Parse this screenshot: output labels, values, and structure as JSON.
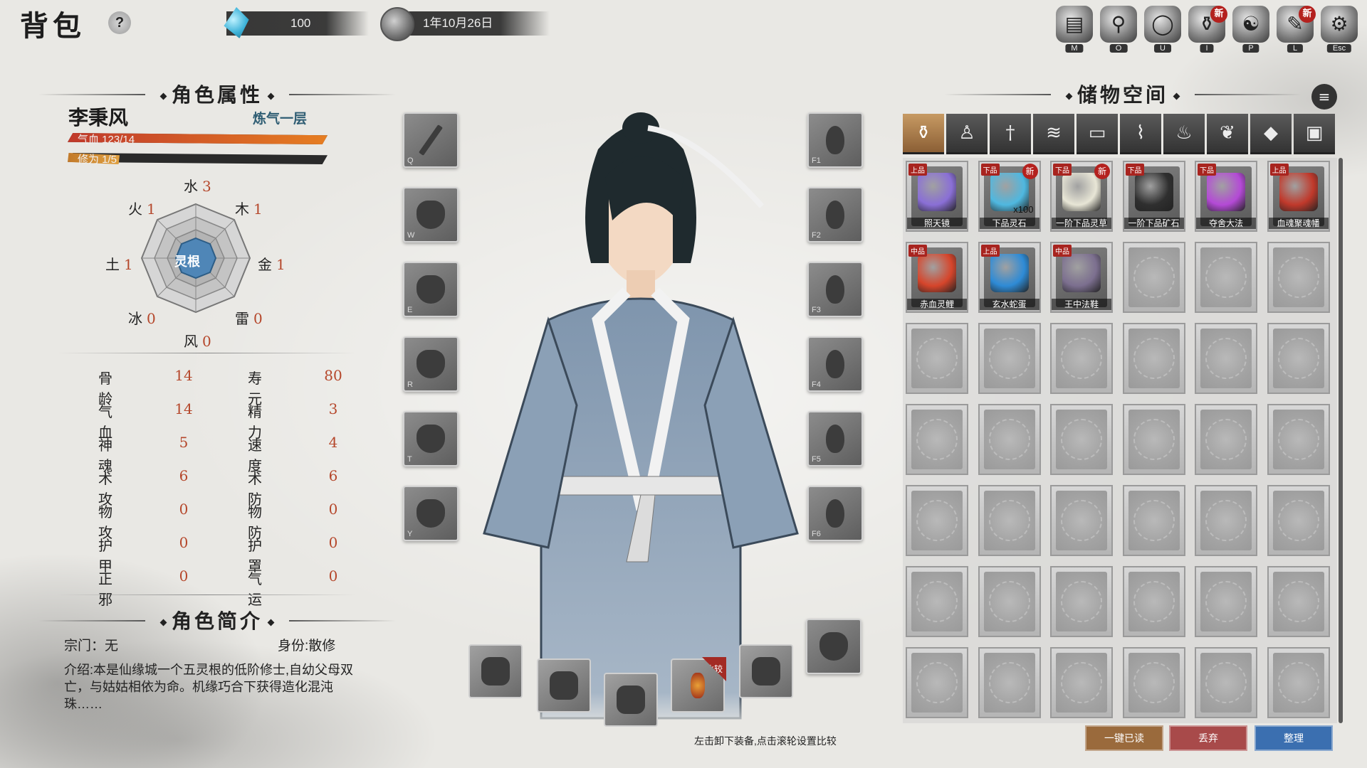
{
  "header": {
    "title": "背包",
    "help": "?",
    "spirit_stone": "100",
    "date": "1年10月26日",
    "menu": [
      {
        "icon": "map-scroll-icon",
        "glyph": "▤",
        "key": "M",
        "new": false
      },
      {
        "icon": "bone-icon",
        "glyph": "⚲",
        "key": "O",
        "new": false
      },
      {
        "icon": "crystal-ball-icon",
        "glyph": "◯",
        "key": "U",
        "new": false
      },
      {
        "icon": "gourd-bag-icon",
        "glyph": "⚱",
        "key": "I",
        "new": true
      },
      {
        "icon": "yin-yang-icon",
        "glyph": "☯",
        "key": "P",
        "new": false
      },
      {
        "icon": "book-brush-icon",
        "glyph": "✎",
        "key": "L",
        "new": true
      },
      {
        "icon": "gear-icon",
        "glyph": "⚙",
        "key": "Esc",
        "new": false
      }
    ],
    "new_label": "新"
  },
  "attributes": {
    "heading": "角色属性",
    "name": "李秉风",
    "rank": "炼气一层",
    "hp_label": "气血 123/14",
    "hp_fraction": 1.0,
    "cultivation_label": "修为 1/5",
    "cultivation_fraction": 0.2,
    "spirit_root": "灵根",
    "elements": [
      {
        "name": "水",
        "value": "3"
      },
      {
        "name": "木",
        "value": "1"
      },
      {
        "name": "金",
        "value": "1"
      },
      {
        "name": "雷",
        "value": "0"
      },
      {
        "name": "风",
        "value": "0"
      },
      {
        "name": "冰",
        "value": "0"
      },
      {
        "name": "土",
        "value": "1"
      },
      {
        "name": "火",
        "value": "1"
      }
    ],
    "stats": [
      {
        "name": "骨龄",
        "value": "14"
      },
      {
        "name": "寿元",
        "value": "80"
      },
      {
        "name": "气血",
        "value": "14"
      },
      {
        "name": "精力",
        "value": "3"
      },
      {
        "name": "神魂",
        "value": "5"
      },
      {
        "name": "速度",
        "value": "4"
      },
      {
        "name": "术攻",
        "value": "6"
      },
      {
        "name": "术防",
        "value": "6"
      },
      {
        "name": "物攻",
        "value": "0"
      },
      {
        "name": "物防",
        "value": "0"
      },
      {
        "name": "护甲",
        "value": "0"
      },
      {
        "name": "护罩",
        "value": "0"
      },
      {
        "name": "正邪",
        "value": "0"
      },
      {
        "name": "气运",
        "value": "0"
      }
    ]
  },
  "profile": {
    "heading": "角色简介",
    "sect": "宗门：无",
    "identity": "身份:散修",
    "bio": "介绍:本是仙缘城一个五灵根的低阶修士,自幼父母双亡，与姑姑相依为命。机缘巧合下获得造化混沌珠……"
  },
  "equipment": {
    "left_keys": [
      "Q",
      "W",
      "E",
      "R",
      "T",
      "Y"
    ],
    "right_keys": [
      "F1",
      "F2",
      "F3",
      "F4",
      "F5",
      "F6"
    ],
    "compare_label": "比较",
    "hint": "左击卸下装备,点击滚轮设置比较"
  },
  "storage": {
    "heading": "储物空间",
    "tabs": [
      {
        "icon": "bag-icon",
        "glyph": "⚱"
      },
      {
        "icon": "robe-icon",
        "glyph": "♙"
      },
      {
        "icon": "sword-icon",
        "glyph": "†"
      },
      {
        "icon": "scroll-icon",
        "glyph": "≋"
      },
      {
        "icon": "book-icon",
        "glyph": "▭"
      },
      {
        "icon": "talisman-icon",
        "glyph": "⌇"
      },
      {
        "icon": "gourd-icon",
        "glyph": "♨"
      },
      {
        "icon": "herb-icon",
        "glyph": "❦"
      },
      {
        "icon": "ore-icon",
        "glyph": "◆"
      },
      {
        "icon": "chest-icon",
        "glyph": "▣"
      }
    ],
    "items": [
      {
        "name": "照天镜",
        "grade": "上品",
        "new": false,
        "qty": "",
        "color": "#8a6fd6"
      },
      {
        "name": "下品灵石",
        "grade": "下品",
        "new": true,
        "qty": "x100",
        "color": "#4fb8e0"
      },
      {
        "name": "一阶下品灵草",
        "grade": "下品",
        "new": true,
        "qty": "",
        "color": "#e8e6d6"
      },
      {
        "name": "一阶下品矿石",
        "grade": "下品",
        "new": false,
        "qty": "",
        "color": "#2f2f2f"
      },
      {
        "name": "夺舍大法",
        "grade": "下品",
        "new": false,
        "qty": "",
        "color": "#b44ad6"
      },
      {
        "name": "血魂聚魂幡",
        "grade": "上品",
        "new": false,
        "qty": "",
        "color": "#c0392b"
      },
      {
        "name": "赤血灵鲤",
        "grade": "中品",
        "new": false,
        "qty": "",
        "color": "#d6452b"
      },
      {
        "name": "玄水蛇蛋",
        "grade": "上品",
        "new": false,
        "qty": "",
        "color": "#2e8bd6"
      },
      {
        "name": "王中法鞋",
        "grade": "中品",
        "new": false,
        "qty": "",
        "color": "#7c6f8f"
      }
    ],
    "buttons": [
      {
        "label": "一键已读",
        "color": "#9a6a3c"
      },
      {
        "label": "丢弃",
        "color": "#a84a4a"
      },
      {
        "label": "整理",
        "color": "#3b6fb0"
      }
    ],
    "list_icon": "≡"
  }
}
